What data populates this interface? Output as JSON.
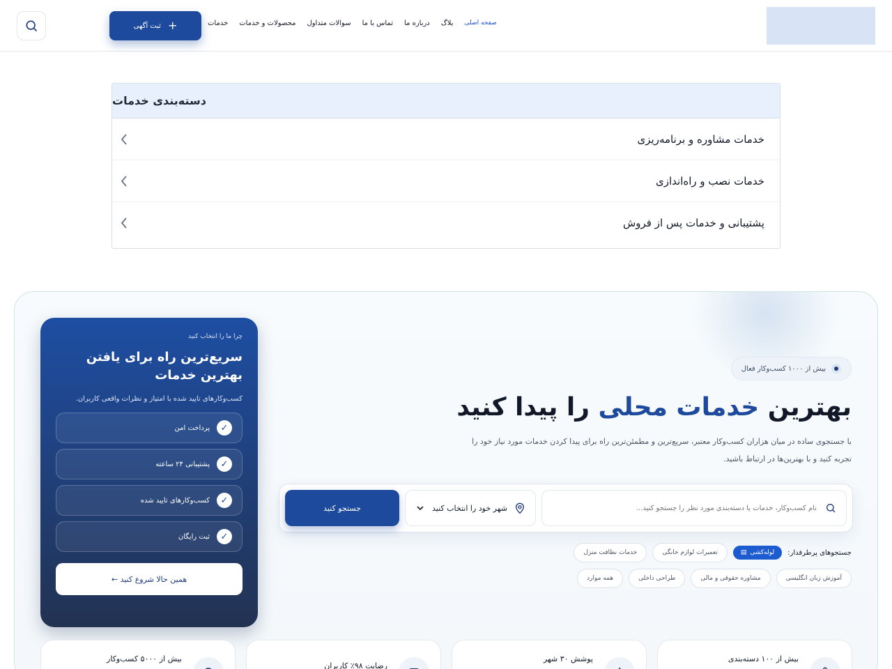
{
  "header": {
    "cta_label": "ثبت آگهی",
    "cta_icon": "+",
    "nav": [
      "خدمات",
      "محصولات و خدمات",
      "سوالات متداول",
      "تماس با ما",
      "درباره ما",
      "بلاگ",
      "صفحه اصلی"
    ],
    "nav_accent_index": 6
  },
  "menu": {
    "title": "دسته‌بندی خدمات",
    "items": [
      "خدمات مشاوره و برنامه‌ریزی",
      "خدمات نصب و راه‌اندازی",
      "پشتیبانی و خدمات پس از فروش"
    ]
  },
  "hero": {
    "badge": "بیش از ۱۰۰۰ کسب‌وکار فعال",
    "headline_part1": "بهترین",
    "headline_highlight": "خدمات محلی",
    "headline_part2": "را پیدا کنید",
    "subtext": "با جستجوی ساده در میان هزاران کسب‌وکار معتبر، سریع‌ترین و مطمئن‌ترین راه برای پیدا کردن خدمات مورد نیاز خود را تجربه کنید و با بهترین‌ها در ارتباط باشید.",
    "search": {
      "placeholder": "نام کسب‌وکار، خدمات یا دسته‌بندی مورد نظر را جستجو کنید...",
      "location": "شهر خود را انتخاب کنید",
      "submit": "جستجو کنید"
    },
    "popular_label": "جستجوهای پرطرفدار:",
    "chips_row1": [
      {
        "label": "لوله‌کشی",
        "active": true
      },
      {
        "label": "تعمیرات لوازم خانگی",
        "active": false
      },
      {
        "label": "خدمات نظافت منزل",
        "active": false
      }
    ],
    "chips_row2": [
      "آموزش زبان انگلیسی",
      "مشاوره حقوقی و مالی",
      "طراحی داخلی",
      "همه موارد"
    ]
  },
  "card": {
    "eyebrow": "چرا ما را انتخاب کنید",
    "title": "سریع‌ترین راه برای یافتن بهترین خدمات",
    "desc": "کسب‌وکارهای تایید شده با امتیاز و نظرات واقعی کاربران.",
    "features": [
      "پرداخت امن",
      "پشتیبانی ۲۴ ساعته",
      "کسب‌وکارهای تایید شده",
      "ثبت رایگان"
    ],
    "button": "همین حالا شروع کنید"
  },
  "stats": [
    "بیش از ۵۰۰۰ کسب‌وکار",
    "رضایت ۹۸٪ کاربران",
    "پوشش ۳۰ شهر",
    "بیش از ۱۰۰ دسته‌بندی"
  ]
}
